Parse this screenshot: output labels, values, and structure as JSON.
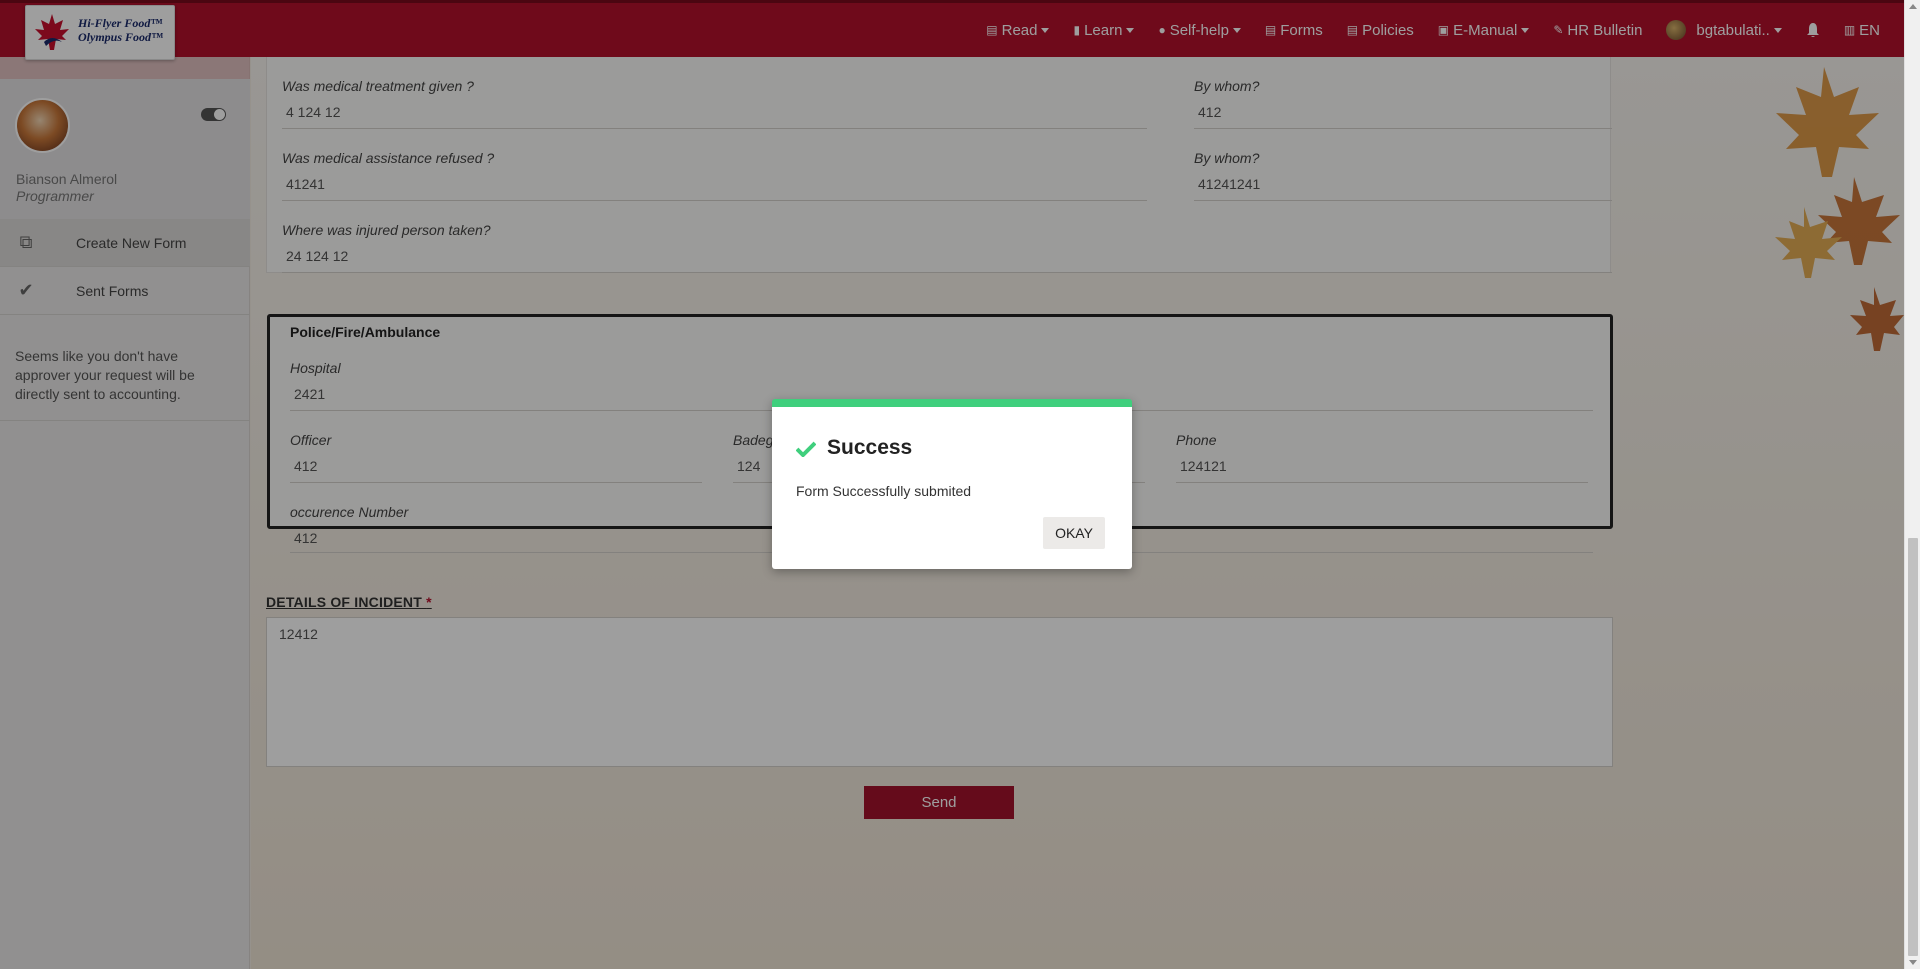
{
  "brand": {
    "line1": "Hi-Flyer Food™",
    "line2": "Olympus Food™"
  },
  "nav": {
    "items": [
      {
        "label": "Read",
        "icon": "newspaper-icon",
        "dropdown": true
      },
      {
        "label": "Learn",
        "icon": "book-icon",
        "dropdown": true
      },
      {
        "label": "Self-help",
        "icon": "question-circle-icon",
        "dropdown": true
      },
      {
        "label": "Forms",
        "icon": "form-icon",
        "dropdown": false
      },
      {
        "label": "Policies",
        "icon": "policy-icon",
        "dropdown": false
      },
      {
        "label": "E-Manual",
        "icon": "manual-icon",
        "dropdown": true
      },
      {
        "label": "HR Bulletin",
        "icon": "pin-icon",
        "dropdown": false
      }
    ],
    "user": "bgtabulati..",
    "lang": "EN"
  },
  "sidebar": {
    "name": "Bianson Almerol",
    "role": "Programmer",
    "items": [
      {
        "label": "Create New Form",
        "icon": "copy-icon"
      },
      {
        "label": "Sent Forms",
        "icon": "check-icon"
      }
    ],
    "note": "Seems like you don't have approver your request will be directly sent to accounting."
  },
  "form": {
    "medical_treatment": {
      "label": "Was medical treatment given ?",
      "value": "4 124 12"
    },
    "medical_treatment_by": {
      "label": "By whom?",
      "value": "412"
    },
    "medical_refused": {
      "label": "Was medical assistance refused ?",
      "value": "41241"
    },
    "medical_refused_by": {
      "label": "By whom?",
      "value": "41241241"
    },
    "injured_taken": {
      "label": "Where was injured person taken?",
      "value": "24 124 12"
    },
    "pfa": {
      "title": "Police/Fire/Ambulance",
      "hospital": {
        "label": "Hospital",
        "value": "2421"
      },
      "officer": {
        "label": "Officer",
        "value": "412"
      },
      "badge": {
        "label": "Badeg",
        "value": "124"
      },
      "phone": {
        "label": "Phone",
        "value": "124121"
      },
      "occurence": {
        "label": "occurence Number",
        "value": "412"
      }
    },
    "details": {
      "label": "DETAILS OF INCIDENT",
      "required_mark": "*",
      "value": "12412"
    },
    "send_label": "Send"
  },
  "modal": {
    "title": "Success",
    "message": "Form Successfully submited",
    "ok_label": "OKAY",
    "accent": "#3fcf7d"
  },
  "colors": {
    "brand": "#b3112d"
  }
}
